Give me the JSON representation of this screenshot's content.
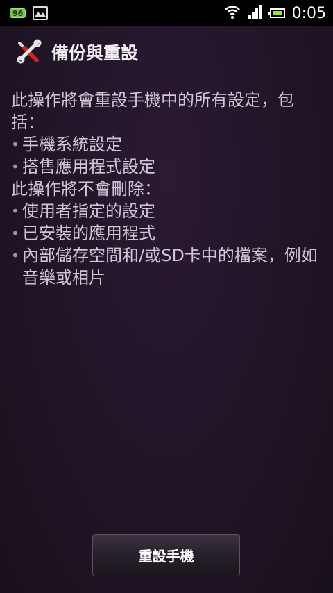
{
  "statusbar": {
    "badge": "96",
    "time": "0:05"
  },
  "header": {
    "title": "備份與重設"
  },
  "content": {
    "intro": "此操作將會重設手機中的所有設定，包括：",
    "reset_items": [
      "手機系統設定",
      "搭售應用程式設定"
    ],
    "keep_heading": "此操作將不會刪除：",
    "keep_items": [
      "使用者指定的設定",
      "已安裝的應用程式",
      "內部儲存空間和/或SD卡中的檔案，例如音樂或相片"
    ]
  },
  "button": {
    "label": "重設手機"
  },
  "icons": {
    "battery_fill": "#9de03a",
    "badge_bg": "#7cc24a"
  }
}
